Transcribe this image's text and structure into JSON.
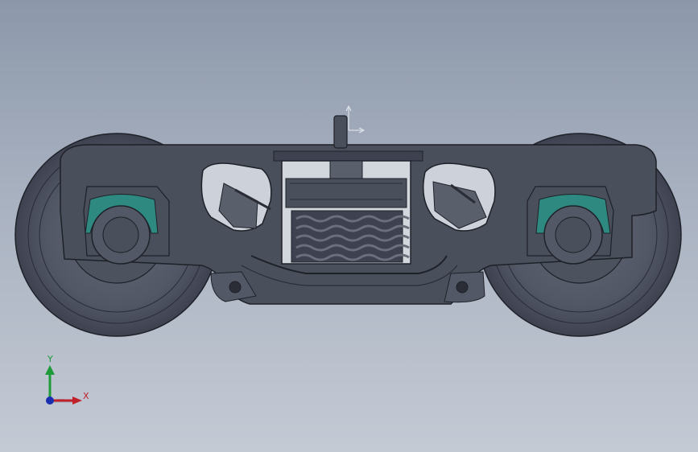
{
  "viewport": {
    "background_top": "#8c98aa",
    "background_bottom": "#c4cad4"
  },
  "model": {
    "body_color": "#4a4f5c",
    "edge_color": "#1e2128",
    "accent_color": "#2e8a80",
    "wheel_color": "#565b68"
  },
  "triad": {
    "y_label": "Y",
    "x_label": "X",
    "y_color": "#1f9a3a",
    "x_color": "#c0202a",
    "z_color": "#1a2fb0"
  },
  "sketch_origin_icon": "origin-arrows-icon"
}
